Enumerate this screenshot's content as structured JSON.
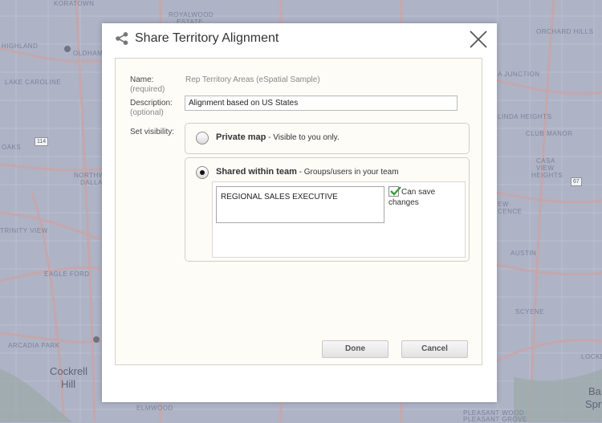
{
  "map": {
    "labels": {
      "koratown": "KORATOWN",
      "royalwood": "ROYALWOOD",
      "estate": "ESTATE",
      "highland": "HIGHLAND",
      "oldham": "OLDHAM",
      "lake_caroline": "LAKE CAROLINE",
      "oaks": "OAKS",
      "northwest": "NORTHWEST",
      "dallas": "DALLAS",
      "trinity_view": "TRINITY VIEW",
      "eagle_ford": "EAGLE FORD",
      "arcadia_park": "ARCADIA PARK",
      "elmwood": "ELMWOOD",
      "orchard_hills": "ORCHARD HILLS",
      "junction": "A JUNCTION",
      "linda_heights": "LINDA HEIGHTS",
      "club_manor": "CLUB MANOR",
      "casa": "CASA",
      "view": "VIEW",
      "heights": "HEIGHTS",
      "ew": "EW",
      "cence": "CENCE",
      "austin": "AUSTIN",
      "scyene": "SCYENE",
      "locke": "LOCKE",
      "pleasant_wood": "PLEASANT WOOD",
      "pleasant_grove": "PLEASANT GROVE",
      "cockrell": "Cockrell",
      "hill": "Hill",
      "ba": "Ba",
      "spr": "Spr",
      "shield_114": "114",
      "shield_67": "67"
    }
  },
  "dialog": {
    "title": "Share Territory Alignment",
    "name_label": "Name:",
    "name_hint": "(required)",
    "name_value": "Rep Territory Areas (eSpatial Sample)",
    "description_label": "Description:",
    "description_hint": "(optional)",
    "description_value": "Alignment based on US States",
    "visibility_label": "Set visibility:",
    "private_title": "Private map",
    "private_desc": " - Visible to you only.",
    "shared_title": "Shared within team",
    "shared_desc": " - Groups/users in your team",
    "team_items": [
      "REGIONAL SALES EXECUTIVE"
    ],
    "can_save_label": "Can save changes",
    "done_label": "Done",
    "cancel_label": "Cancel"
  },
  "colors": {
    "map_background": "#aeb3c6",
    "road": "#c9a6a8",
    "checkmark": "#3f9b3f"
  }
}
